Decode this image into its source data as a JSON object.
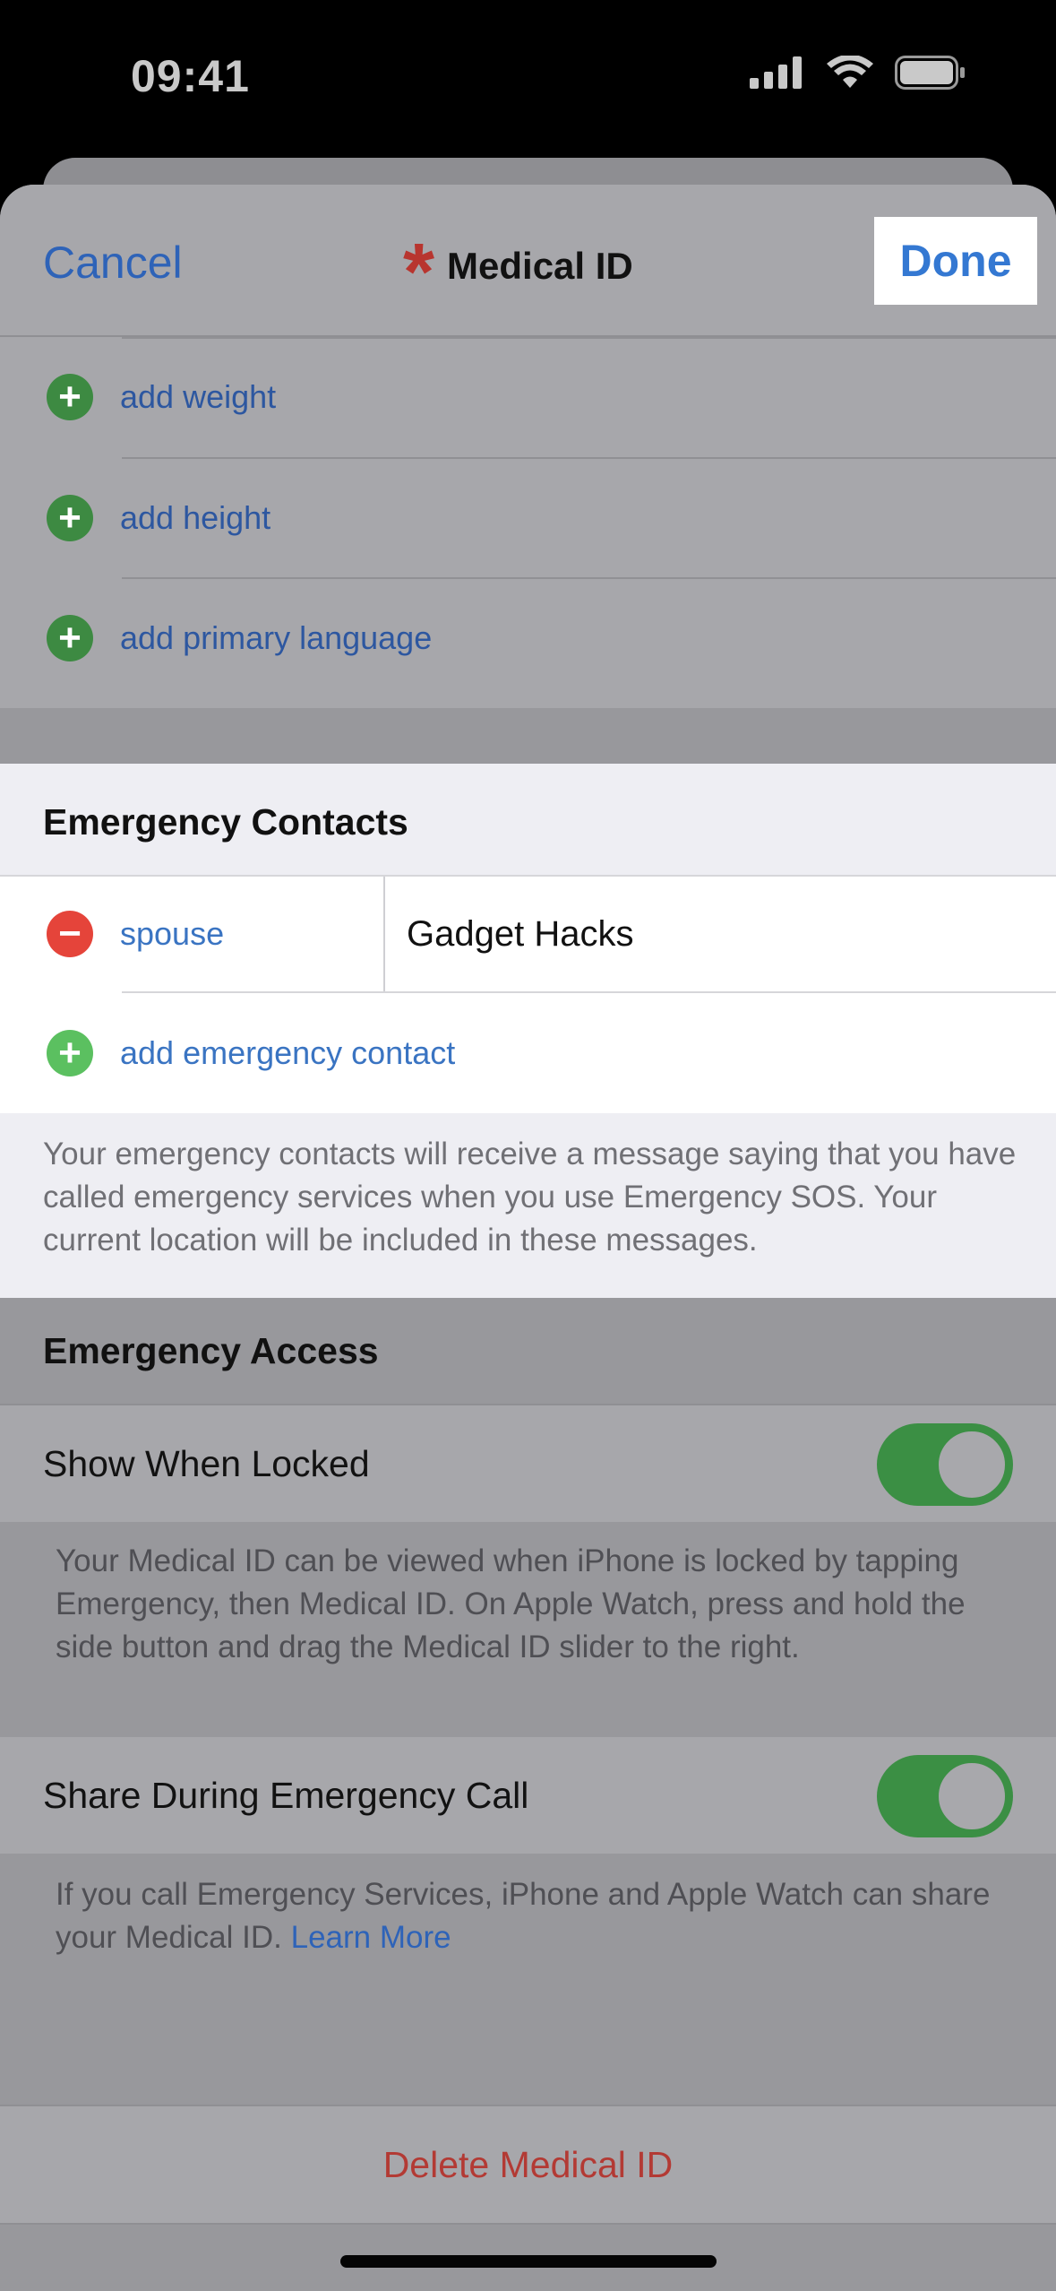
{
  "status_bar": {
    "time": "09:41"
  },
  "nav": {
    "cancel": "Cancel",
    "title": "Medical ID",
    "star": "*",
    "done": "Done"
  },
  "details_rows": [
    {
      "label": "add weight"
    },
    {
      "label": "add height"
    },
    {
      "label": "add primary language"
    }
  ],
  "emergency_contacts": {
    "header": "Emergency Contacts",
    "contact": {
      "relationship": "spouse",
      "name": "Gadget Hacks"
    },
    "add_label": "add emergency contact",
    "footer": "Your emergency contacts will receive a message saying that you have called emergency services when you use Emergency SOS. Your current location will be included in these messages."
  },
  "emergency_access": {
    "header": "Emergency Access",
    "show_when_locked": {
      "label": "Show When Locked",
      "on": true
    },
    "show_footer": "Your Medical ID can be viewed when iPhone is locked by tapping Emergency, then Medical ID. On Apple Watch, press and hold the side button and drag the Medical ID slider to the right.",
    "share_call": {
      "label": "Share During Emergency Call",
      "on": true
    },
    "share_footer": "If you call Emergency Services, iPhone and Apple Watch can share your Medical ID.",
    "learn_more": "Learn More"
  },
  "delete_label": "Delete Medical ID",
  "colors": {
    "accent": "#3478d2",
    "destructive": "#b33a34",
    "toggle_on": "#3b8f44"
  }
}
